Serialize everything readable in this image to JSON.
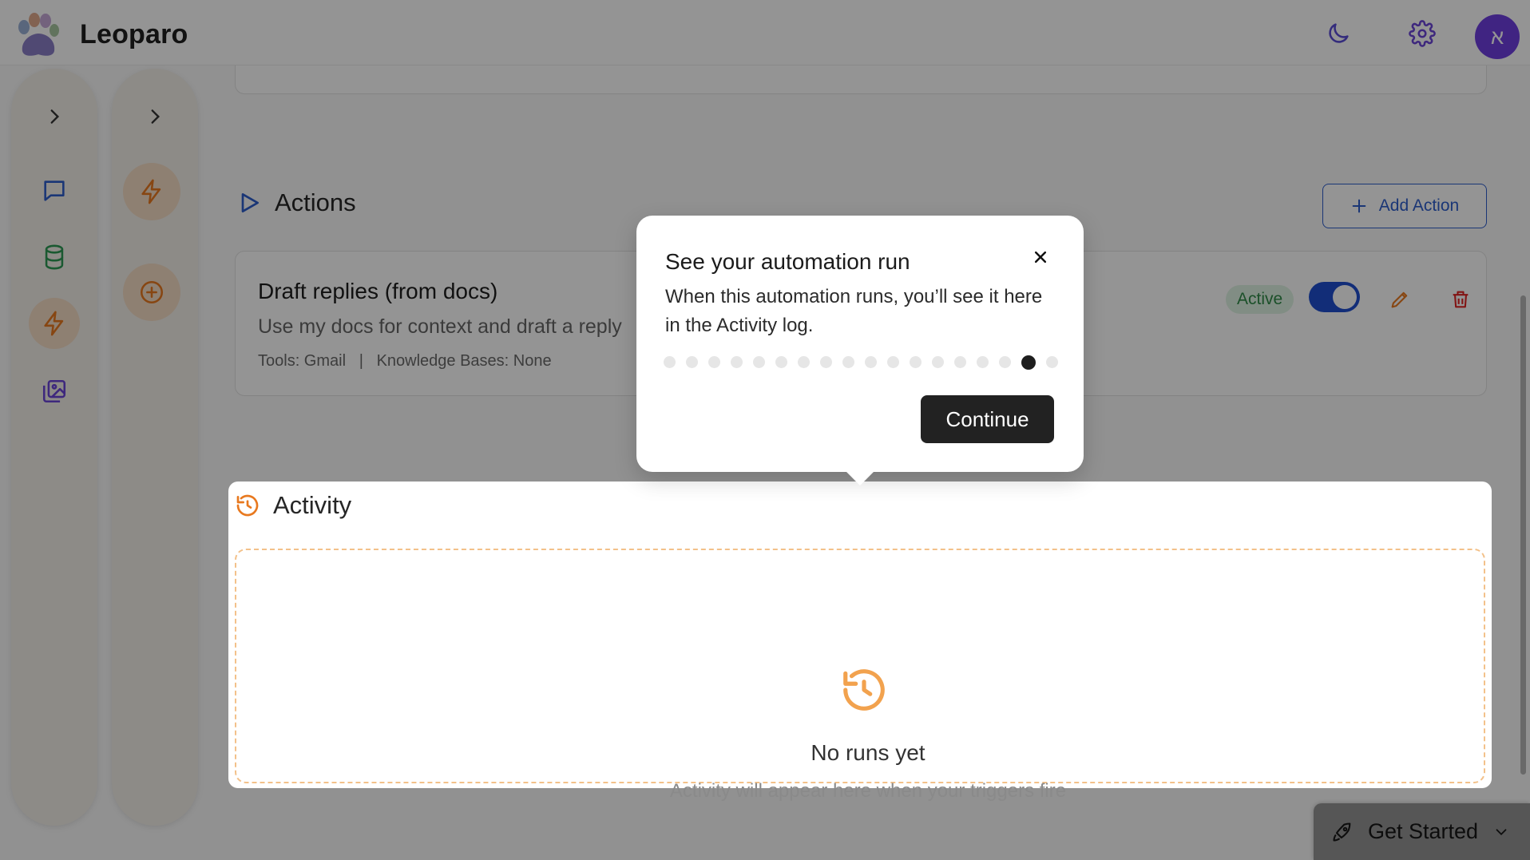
{
  "app": {
    "name": "Leoparo",
    "avatar_initial": "א"
  },
  "header": {
    "theme_toggle_icon": "moon-icon",
    "settings_icon": "gear-icon"
  },
  "actions_section": {
    "title": "Actions",
    "add_button_label": "Add Action",
    "card": {
      "title": "Draft replies (from docs)",
      "description": "Use my docs for context and draft a reply",
      "meta": "Tools: Gmail   |   Knowledge Bases: None",
      "status": "Active",
      "enabled": true
    }
  },
  "activity_section": {
    "title": "Activity",
    "empty_title": "No runs yet",
    "empty_subtitle": "Activity will appear here when your triggers fire"
  },
  "tour": {
    "title": "See your automation run",
    "body": "When this automation runs, you’ll see it here in the Activity log.",
    "total_steps": 18,
    "current_step": 17,
    "continue_label": "Continue"
  },
  "get_started": {
    "label": "Get Started"
  },
  "colors": {
    "accent_orange": "#e8791f",
    "primary_blue": "#2e5dcc",
    "avatar_purple": "#6f3fe0"
  }
}
